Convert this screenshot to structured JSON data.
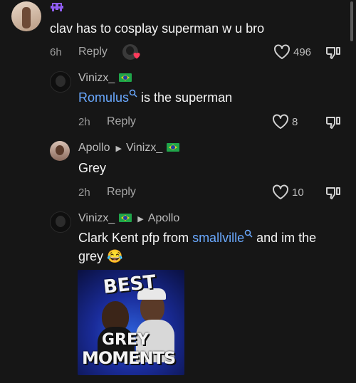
{
  "comment": {
    "text": "clav has to cosplay superman w u bro",
    "time": "6h",
    "reply_label": "Reply",
    "likes": "496"
  },
  "replies": [
    {
      "username": "Vinizx_",
      "mention": "Romulus",
      "text_after": " is the superman",
      "time": "2h",
      "reply_label": "Reply",
      "likes": "8"
    },
    {
      "username": "Apollo",
      "reply_to": "Vinizx_",
      "text": "Grey",
      "time": "2h",
      "reply_label": "Reply",
      "likes": "10"
    },
    {
      "username": "Vinizx_",
      "reply_to": "Apollo",
      "text_before": "Clark Kent pfp from ",
      "mention": "smallville",
      "text_after": " and im the",
      "text_line2": "grey",
      "emoji": "😂",
      "image_text": {
        "line1": "BEST",
        "line2": "GREY",
        "line3": "MOMENTS"
      }
    }
  ],
  "colors": {
    "background": "#161616",
    "mention": "#6aa9ff",
    "heart_badge": "#ff3b5c",
    "flag_green": "#1fa54a"
  },
  "icons": [
    "alien-icon",
    "heart-outline-icon",
    "dislike-icon",
    "search-icon",
    "caret-right-icon",
    "brazil-flag-icon"
  ]
}
